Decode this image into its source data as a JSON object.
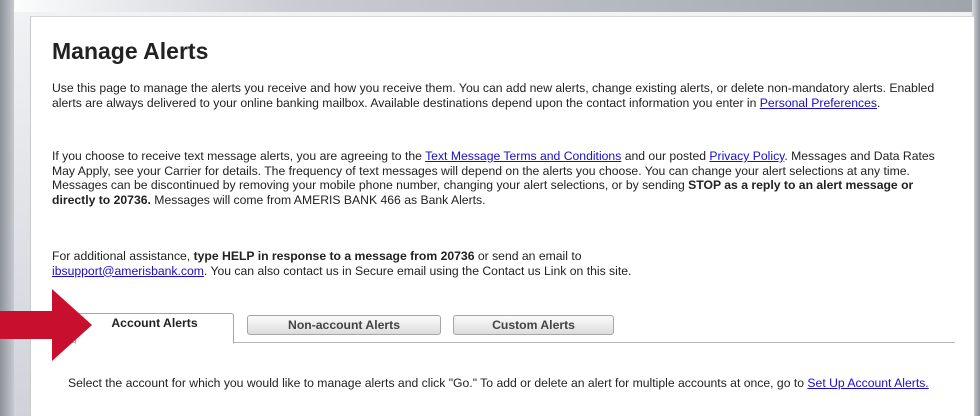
{
  "page": {
    "title": "Manage Alerts"
  },
  "intro": {
    "text1": "Use this page to manage the alerts you receive and how you receive them. You can add new alerts, change existing alerts, or delete non-mandatory alerts. Enabled alerts are always delivered to your online banking mailbox. Available destinations depend upon the contact information you enter in ",
    "link_personal_preferences": "Personal Preferences",
    "text1_end": "."
  },
  "text_alerts": {
    "t1": "If you choose to receive text message alerts, you are agreeing to the ",
    "link_terms": "Text Message Terms and Conditions",
    "t2": " and our posted ",
    "link_privacy": "Privacy Policy",
    "t3": ". Messages and Data Rates May Apply, see your Carrier for details. The frequency of text messages will depend on the alerts you choose. You can change your alert selections at any time. Messages can be discontinued by removing your mobile phone number, changing your alert selections, or by sending ",
    "bold_stop": "STOP as a reply to an alert message or directly to 20736.",
    "t4": " Messages will come from AMERIS BANK 466 as Bank Alerts."
  },
  "assistance": {
    "t1": "For additional assistance, ",
    "bold_help": "type HELP in response to a message from 20736",
    "t2": " or send an email to ",
    "link_email": "ibsupport@amerisbank.com",
    "t3": ". You can also contact us in Secure email using the Contact us Link on this site."
  },
  "tabs": [
    {
      "label": "Account Alerts",
      "active": true
    },
    {
      "label": "Non-account Alerts",
      "active": false
    },
    {
      "label": "Custom Alerts",
      "active": false
    }
  ],
  "account_section": {
    "text": "Select the account for which you would like to manage alerts and click \"Go.\" To add or delete an alert for multiple accounts at once, go to ",
    "link_setup": "Set Up Account Alerts."
  },
  "colors": {
    "link": "#1a0dcc",
    "arrow": "#c8102e"
  },
  "icons": {
    "pointer_arrow": "arrow-right-icon"
  }
}
